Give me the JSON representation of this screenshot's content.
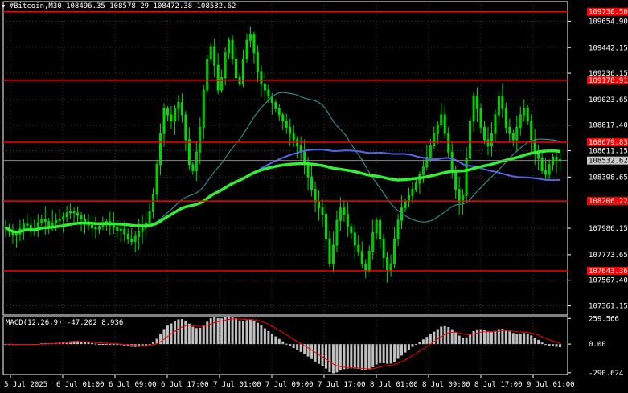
{
  "header": {
    "symbol_text": "#Bitcoin,M30  108496.35 108578.29 108472.38 108532.62",
    "arrow_glyph": "▼"
  },
  "colors": {
    "background": "#000000",
    "grid": "#3a3a3a",
    "candles": "#00dd00",
    "ma_green": "#33ee33",
    "ma_blue": "#5566ee",
    "ma_teal": "#2a8a8a",
    "hlines": "#ff0000",
    "price_tag_red": "#ff0000",
    "price_tag_current": "#c8c8c8",
    "macd_hist": "#c0c0c0",
    "macd_signal": "#ff0000",
    "axis_text": "#ffffff"
  },
  "price_axis": {
    "labels": [
      "109654.90",
      "109442.15",
      "109236.15",
      "109023.65",
      "108817.40",
      "108611.15",
      "108398.65",
      "107986.15",
      "107773.65",
      "107567.40",
      "107361.15"
    ],
    "ylim": [
      107300,
      109800
    ]
  },
  "hlevels": [
    "109730.50",
    "109178.91",
    "108679.83",
    "108206.22",
    "107643.36"
  ],
  "current_price": "108532.62",
  "macd": {
    "title": "MACD(12,26,9) -47.202 8.936",
    "labels": [
      "259.566",
      "0.00",
      "-290.624"
    ],
    "ylim": [
      -300,
      270
    ]
  },
  "time_axis": {
    "labels": [
      "5 Jul 2025",
      "6 Jul 01:00",
      "6 Jul 09:00",
      "6 Jul 17:00",
      "7 Jul 01:00",
      "7 Jul 09:00",
      "7 Jul 17:00",
      "8 Jul 01:00",
      "8 Jul 09:00",
      "8 Jul 17:00",
      "9 Jul 01:00"
    ]
  },
  "chart_data": {
    "type": "candlestick",
    "timeframe": "M30",
    "bar_step_hours": 0.5,
    "series_note": "close prices per bar",
    "closes": [
      107990,
      107960,
      107930,
      107940,
      107980,
      108020,
      108010,
      107960,
      107980,
      108030,
      108060,
      108040,
      108000,
      108030,
      108050,
      108060,
      108080,
      108110,
      108120,
      108110,
      108090,
      108060,
      108040,
      108010,
      107990,
      107980,
      108000,
      108020,
      108040,
      108010,
      107990,
      107970,
      107980,
      107940,
      107900,
      107880,
      107920,
      107960,
      107990,
      108030,
      108120,
      108260,
      108500,
      108750,
      108950,
      108900,
      108850,
      108950,
      109000,
      108900,
      108700,
      108500,
      108450,
      108600,
      108800,
      109100,
      109350,
      109450,
      109300,
      109100,
      109200,
      109400,
      109500,
      109350,
      109200,
      109150,
      109350,
      109500,
      109550,
      109400,
      109250,
      109150,
      109100,
      109050,
      109000,
      108950,
      108900,
      108850,
      108800,
      108750,
      108700,
      108650,
      108600,
      108500,
      108400,
      108300,
      108200,
      108150,
      108100,
      107900,
      107700,
      107850,
      108050,
      108150,
      108100,
      108000,
      107950,
      107850,
      107800,
      107700,
      107650,
      107800,
      107950,
      108050,
      107900,
      107750,
      107650,
      107700,
      107900,
      108050,
      108150,
      108200,
      108250,
      108300,
      108350,
      108420,
      108480,
      108560,
      108650,
      108750,
      108820,
      108900,
      108750,
      108600,
      108450,
      108300,
      108200,
      108250,
      108550,
      108850,
      109050,
      108950,
      108800,
      108700,
      108650,
      108750,
      108900,
      109050,
      108950,
      108800,
      108750,
      108700,
      108800,
      108900,
      108950,
      108850,
      108700,
      108600,
      108550,
      108450,
      108420,
      108500,
      108560,
      108540,
      108532
    ]
  }
}
